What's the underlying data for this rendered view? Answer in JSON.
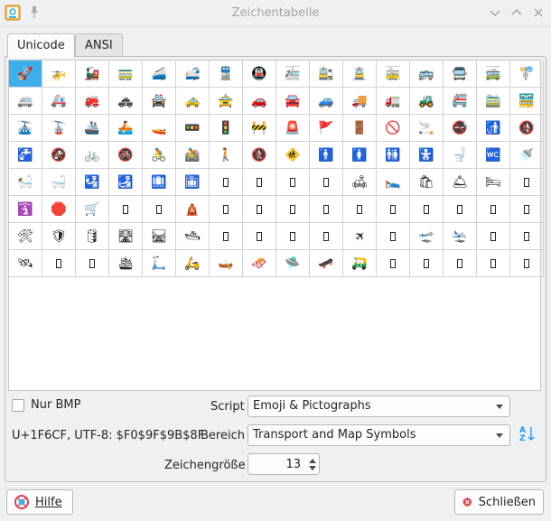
{
  "window": {
    "title": "Zeichentabelle"
  },
  "tabs": [
    {
      "label": "Unicode",
      "active": true
    },
    {
      "label": "ANSI",
      "active": false
    }
  ],
  "grid": {
    "columns": 16,
    "rows": 11,
    "selected_index": 0,
    "cells": [
      "🚀",
      "🚁",
      "🚂",
      "🚃",
      "🚄",
      "🚅",
      "🚆",
      "🚇",
      "🚈",
      "🚉",
      "🚊",
      "🚋",
      "🚌",
      "🚍",
      "🚎",
      "🚏",
      "🚐",
      "🚑",
      "🚒",
      "🚓",
      "🚔",
      "🚕",
      "🚖",
      "🚗",
      "🚘",
      "🚙",
      "🚚",
      "🚛",
      "🚜",
      "🚝",
      "🚞",
      "🚟",
      "🚠",
      "🚡",
      "🚢",
      "🚣",
      "🚤",
      "🚥",
      "🚦",
      "🚧",
      "🚨",
      "🚩",
      "🚪",
      "🚫",
      "🚬",
      "🚭",
      "🚮",
      "🚯",
      "🚰",
      "🚱",
      "🚲",
      "🚳",
      "🚴",
      "🚵",
      "🚶",
      "🚷",
      "🚸",
      "🚹",
      "🚺",
      "🚻",
      "🚼",
      "🚽",
      "🚾",
      "🚿",
      "🛀",
      "🛁",
      "🛂",
      "🛃",
      "🛄",
      "🛅",
      "",
      "",
      "",
      "",
      "🛋",
      "🛌",
      "🛍",
      "🛎",
      "🛏",
      "",
      "🛐",
      "🛑",
      "🛒",
      "",
      "",
      "🛕",
      "",
      "",
      "",
      "",
      "",
      "",
      "",
      "",
      "",
      "",
      "🛠",
      "🛡",
      "🛢",
      "🛣",
      "🛤",
      "🛥",
      "",
      "",
      "",
      "",
      "🛪",
      "",
      "🛫",
      "🛬",
      "",
      "",
      "🛰",
      "",
      "",
      "🛳",
      "🛴",
      "🛵",
      "🛶",
      "🛷",
      "🛸",
      "🛹",
      "🛺",
      "",
      "",
      "",
      "",
      ""
    ],
    "tofu_indices": [
      70,
      71,
      72,
      73,
      79,
      83,
      84,
      86,
      87,
      88,
      89,
      90,
      91,
      92,
      93,
      94,
      95,
      102,
      103,
      104,
      105,
      107,
      110,
      111,
      113,
      114,
      123,
      124,
      125,
      126,
      127
    ]
  },
  "controls": {
    "nur_bmp_label": "Nur BMP",
    "nur_bmp_checked": false,
    "script_label": "Script",
    "script_value": "Emoji & Pictographs",
    "char_info": "U+1F6CF, UTF-8: $F0$9F$9B$8F",
    "bereich_label": "Bereich",
    "bereich_value": "Transport and Map Symbols",
    "size_label": "Zeichengröße",
    "size_value": "13"
  },
  "buttons": {
    "help_label": "Hilfe",
    "close_label": "Schließen"
  },
  "icons": {
    "app": "charmap-icon",
    "pin": "pin-icon",
    "minimize": "chevron-down-icon",
    "maximize": "chevron-up-icon",
    "close": "close-icon",
    "sort": "sort-az-icon",
    "help": "help-icon",
    "close_button": "close-circle-icon"
  },
  "colors": {
    "selection": "#3daee9",
    "close_red": "#da4453"
  }
}
